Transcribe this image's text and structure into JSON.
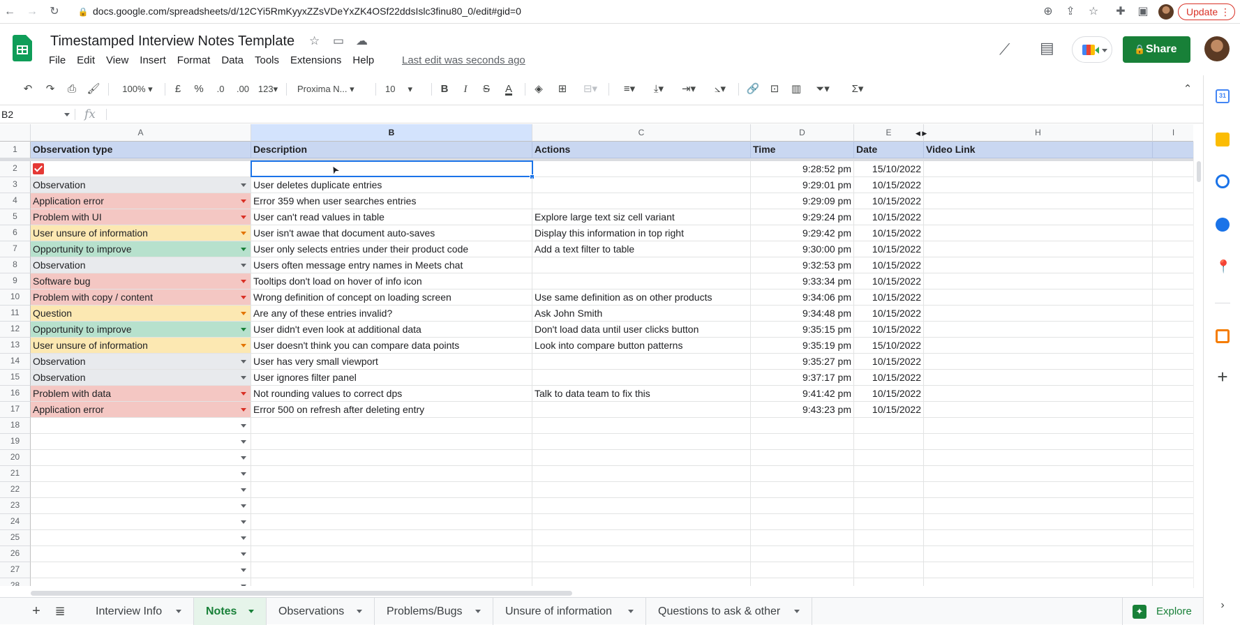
{
  "browser": {
    "url": "docs.google.com/spreadsheets/d/12CYi5RmKyyxZZsVDeYxZK4OSf22ddsIslc3finu80_0/edit#gid=0",
    "update_label": "Update"
  },
  "doc": {
    "title": "Timestamped Interview Notes Template",
    "menus": [
      "File",
      "Edit",
      "View",
      "Insert",
      "Format",
      "Data",
      "Tools",
      "Extensions",
      "Help"
    ],
    "last_edit": "Last edit was seconds ago",
    "share_label": "Share"
  },
  "toolbar": {
    "zoom": "100%",
    "currency": "£",
    "percent": "%",
    "dec_decrease": ".0",
    "dec_increase": ".00",
    "number_format": "123",
    "font": "Proxima N...",
    "font_size": "10",
    "bold": "B",
    "italic": "I",
    "strike": "S",
    "text_color": "A",
    "sum": "Σ"
  },
  "formula_bar": {
    "name_box": "B2",
    "fx": "fx",
    "value": ""
  },
  "columns": [
    "A",
    "B",
    "C",
    "D",
    "E",
    "H",
    "I"
  ],
  "header_row": {
    "a": "Observation type",
    "b": "Description",
    "c": "Actions",
    "d": "Time",
    "e": "Date",
    "h": "Video Link"
  },
  "rows": [
    {
      "n": "2",
      "type": "",
      "desc": "",
      "action": "",
      "time": "9:28:52 pm",
      "date": "15/10/2022",
      "color": "none"
    },
    {
      "n": "3",
      "type": "Observation",
      "desc": "User deletes duplicate entries",
      "action": "",
      "time": "9:29:01 pm",
      "date": "10/15/2022",
      "color": "#e8eaed"
    },
    {
      "n": "4",
      "type": "Application error",
      "desc": "Error 359 when user searches entries",
      "action": "",
      "time": "9:29:09 pm",
      "date": "10/15/2022",
      "color": "#f4c7c3"
    },
    {
      "n": "5",
      "type": "Problem with UI",
      "desc": "User can't read values in table",
      "action": "Explore large text siz cell variant",
      "time": "9:29:24 pm",
      "date": "10/15/2022",
      "color": "#f4c7c3"
    },
    {
      "n": "6",
      "type": "User unsure of information",
      "desc": "User isn't awae that document auto-saves",
      "action": "Display this information in top right",
      "time": "9:29:42 pm",
      "date": "10/15/2022",
      "color": "#fce8b2"
    },
    {
      "n": "7",
      "type": "Opportunity to improve",
      "desc": "User only selects entries under their product code",
      "action": "Add a text filter to table",
      "time": "9:30:00 pm",
      "date": "10/15/2022",
      "color": "#b7e1cd"
    },
    {
      "n": "8",
      "type": "Observation",
      "desc": "Users often message entry names in Meets chat",
      "action": "",
      "time": "9:32:53 pm",
      "date": "10/15/2022",
      "color": "#e8eaed"
    },
    {
      "n": "9",
      "type": "Software bug",
      "desc": "Tooltips don't load on hover of info icon",
      "action": "",
      "time": "9:33:34 pm",
      "date": "10/15/2022",
      "color": "#f4c7c3"
    },
    {
      "n": "10",
      "type": "Problem with copy / content",
      "desc": "Wrong definition of concept on loading screen",
      "action": "Use same definition as on other products",
      "time": "9:34:06 pm",
      "date": "10/15/2022",
      "color": "#f4c7c3"
    },
    {
      "n": "11",
      "type": "Question",
      "desc": "Are any of these entries invalid?",
      "action": "Ask John Smith",
      "time": "9:34:48 pm",
      "date": "10/15/2022",
      "color": "#fce8b2"
    },
    {
      "n": "12",
      "type": "Opportunity to improve",
      "desc": "User didn't even look at additional data",
      "action": "Don't load data until user clicks button",
      "time": "9:35:15 pm",
      "date": "10/15/2022",
      "color": "#b7e1cd"
    },
    {
      "n": "13",
      "type": "User unsure of information",
      "desc": "User doesn't think you can compare data points",
      "action": "Look into compare button patterns",
      "time": "9:35:19 pm",
      "date": "15/10/2022",
      "color": "#fce8b2"
    },
    {
      "n": "14",
      "type": "Observation",
      "desc": "User has very small viewport",
      "action": "",
      "time": "9:35:27 pm",
      "date": "10/15/2022",
      "color": "#e8eaed"
    },
    {
      "n": "15",
      "type": "Observation",
      "desc": "User ignores filter panel",
      "action": "",
      "time": "9:37:17 pm",
      "date": "10/15/2022",
      "color": "#e8eaed"
    },
    {
      "n": "16",
      "type": "Problem with data",
      "desc": "Not rounding values to correct dps",
      "action": "Talk to data team to fix this",
      "time": "9:41:42 pm",
      "date": "10/15/2022",
      "color": "#f4c7c3"
    },
    {
      "n": "17",
      "type": "Application error",
      "desc": "Error 500 on refresh after deleting entry",
      "action": "",
      "time": "9:43:23 pm",
      "date": "10/15/2022",
      "color": "#f4c7c3"
    }
  ],
  "empty_rows": [
    "18",
    "19",
    "20",
    "21",
    "22",
    "23",
    "24",
    "25",
    "26",
    "27",
    "28"
  ],
  "row1_label": "1",
  "sheet_tabs": [
    "Interview Info",
    "Notes",
    "Observations",
    "Problems/Bugs",
    "Unsure of information",
    "Questions to ask & other"
  ],
  "active_tab": "Notes",
  "explore_label": "Explore",
  "side_panel_icons": [
    "calendar-icon",
    "keep-icon",
    "tasks-icon",
    "contacts-icon",
    "maps-icon",
    "office-icon",
    "add-icon"
  ]
}
